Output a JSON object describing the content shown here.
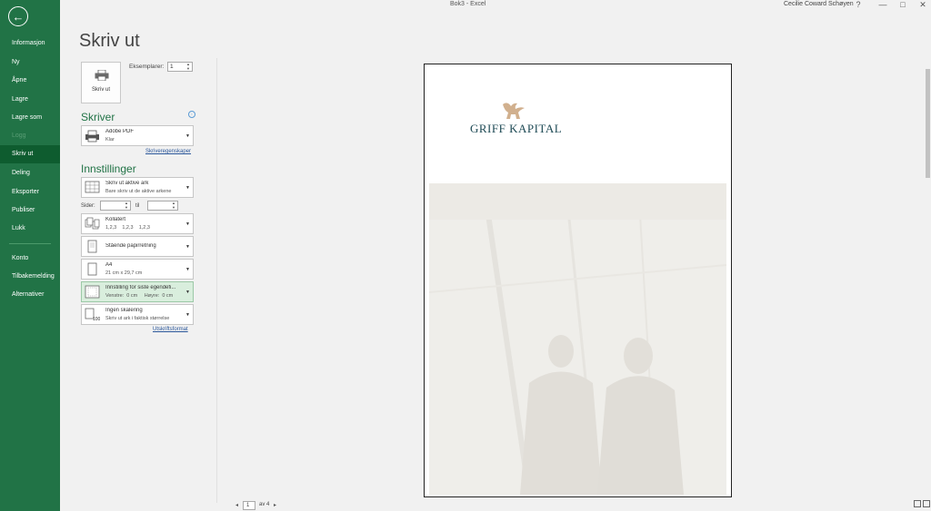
{
  "window": {
    "title": "Bok3 - Excel",
    "user": "Cecilie Coward Schøyen",
    "help": "?",
    "minimize": "—",
    "maximize": "□",
    "close": "✕"
  },
  "sidebar": {
    "back_icon": "back-arrow-icon",
    "items": [
      {
        "label": "Informasjon"
      },
      {
        "label": "Ny"
      },
      {
        "label": "Åpne"
      },
      {
        "label": "Lagre"
      },
      {
        "label": "Lagre som"
      },
      {
        "label": "Logg"
      },
      {
        "label": "Skriv ut"
      },
      {
        "label": "Deling"
      },
      {
        "label": "Eksporter"
      },
      {
        "label": "Publiser"
      },
      {
        "label": "Lukk"
      },
      {
        "label": "Konto"
      },
      {
        "label": "Tilbakemelding"
      },
      {
        "label": "Alternativer"
      }
    ]
  },
  "print": {
    "title": "Skriv ut",
    "print_button": "Skriv ut",
    "copies_label": "Eksemplarer:",
    "copies_value": "1",
    "printer_section": "Skriver",
    "printer": {
      "name": "Adobe PDF",
      "status": "Klar"
    },
    "printer_properties_link": "Skriveregenskaper",
    "settings_section": "Innstillinger",
    "settings": [
      {
        "main": "Skriv ut aktive ark",
        "sub": "Bare skriv ut de aktive arkene"
      },
      {
        "main": "Kollatert",
        "sub": "1,2,3    1,2,3    1,2,3"
      },
      {
        "main": "Stående papirretning",
        "sub": ""
      },
      {
        "main": "A4",
        "sub": "21 cm x 29,7 cm"
      },
      {
        "main": "Innstilling for siste egendefi...",
        "sub": "Venstre:  0 cm     Høyre:  0 cm"
      },
      {
        "main": "Ingen skalering",
        "sub": "Skriv ut ark i faktisk størrelse"
      }
    ],
    "pages_label": "Sider:",
    "pages_to": "til",
    "page_setup_link": "Utskriftsformat"
  },
  "preview": {
    "logo_text": "GRIFF KAPITAL",
    "current_page": "1",
    "page_of": "av 4"
  },
  "colors": {
    "accent": "#217346",
    "accent_dark": "#0e5c2f",
    "logo": "#1e4a55",
    "logo_gold": "#c9a27a"
  }
}
